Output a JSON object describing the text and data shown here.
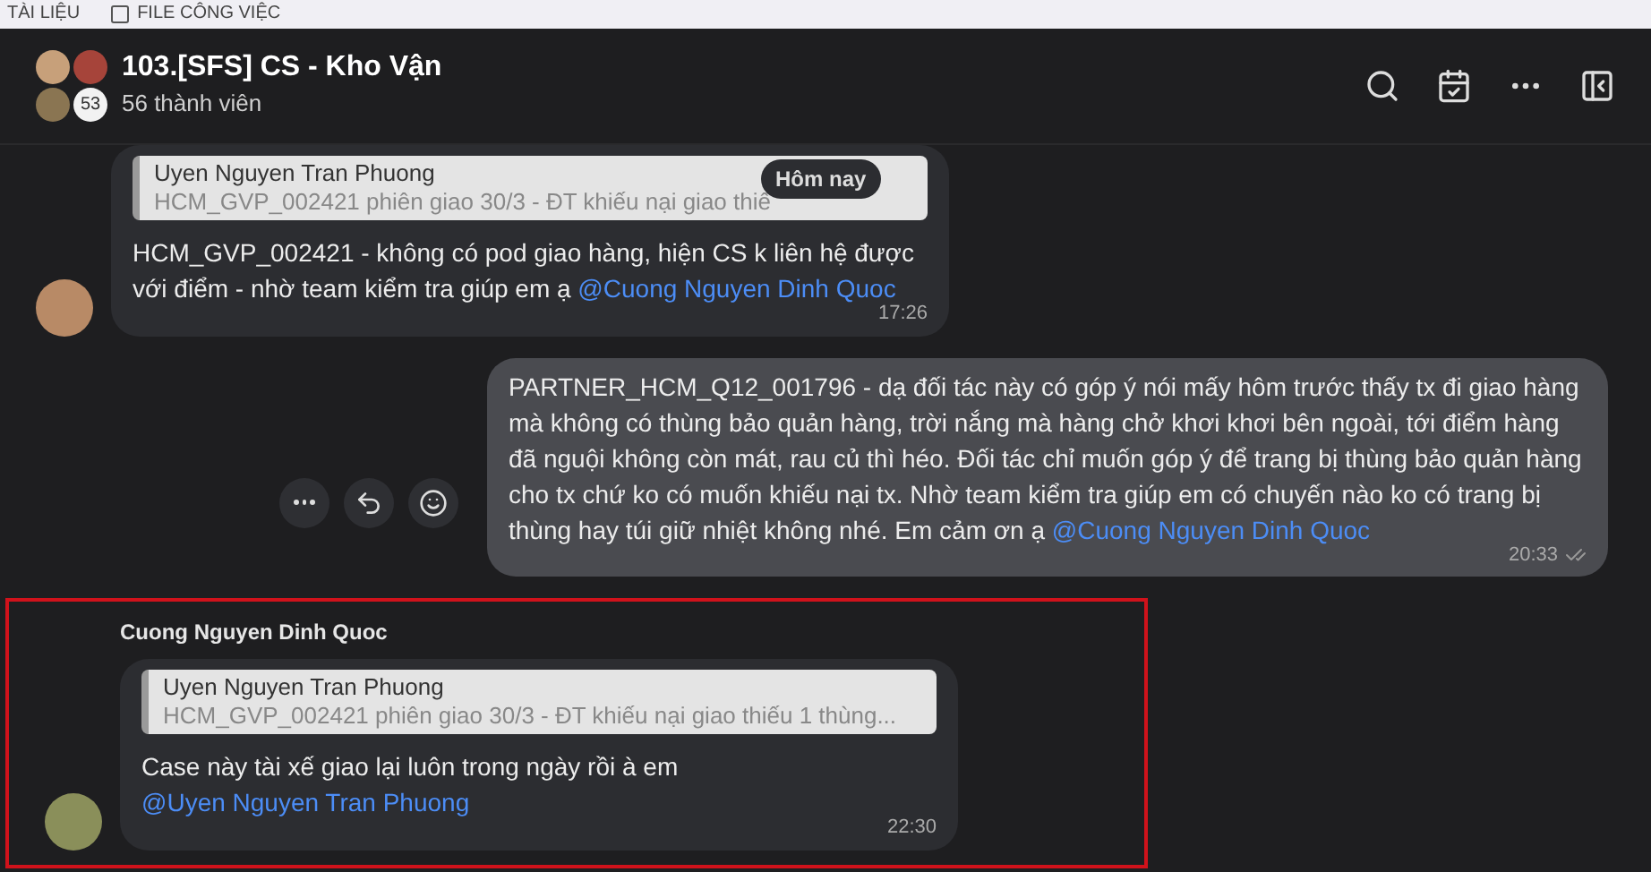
{
  "top_strip": {
    "items": [
      {
        "label": "TÀI LIỆU",
        "kind": "text"
      },
      {
        "label": "FILE CÔNG VIỆC",
        "kind": "checkbox"
      }
    ]
  },
  "header": {
    "title": "103.[SFS] CS - Kho Vận",
    "subtitle": "56 thành viên",
    "avatar_count": "53"
  },
  "date_pill": "Hôm nay",
  "messages": [
    {
      "kind": "incoming",
      "quote": {
        "author": "Uyen Nguyen Tran Phuong",
        "text": "HCM_GVP_002421 phiên giao 30/3 - ĐT khiếu nại giao thiế"
      },
      "text": "HCM_GVP_002421 - không có pod giao hàng, hiện CS k liên hệ được với điểm - nhờ team kiểm tra giúp em ạ",
      "mention": "@Cuong Nguyen Dinh Quoc",
      "time": "17:26",
      "read": false,
      "highlighted": false
    },
    {
      "kind": "outgoing",
      "text": "PARTNER_HCM_Q12_001796  - dạ đối tác này có góp ý nói mấy hôm trước thấy tx đi giao hàng mà không có thùng bảo quản hàng, trời nắng mà hàng chở khơi khơi bên ngoài, tới điểm hàng đã nguội không còn mát, rau củ thì héo. Đối tác chỉ muốn góp ý để trang bị thùng bảo quản hàng cho tx chứ ko có muốn khiếu nại tx. Nhờ team kiểm tra giúp em có chuyến nào ko có trang bị thùng hay túi giữ nhiệt không nhé. Em cảm ơn ạ",
      "mention": "@Cuong Nguyen Dinh Quoc",
      "time": "20:33",
      "read": true,
      "highlighted": false
    },
    {
      "kind": "incoming",
      "sender": "Cuong Nguyen Dinh Quoc",
      "quote": {
        "author": "Uyen Nguyen Tran Phuong",
        "text": "HCM_GVP_002421 phiên giao 30/3 - ĐT khiếu nại giao thiếu 1 thùng..."
      },
      "text": "Case này tài xế giao lại luôn trong ngày rồi à em",
      "mention": "@Uyen Nguyen Tran Phuong",
      "time": "22:30",
      "read": false,
      "highlighted": true
    }
  ]
}
